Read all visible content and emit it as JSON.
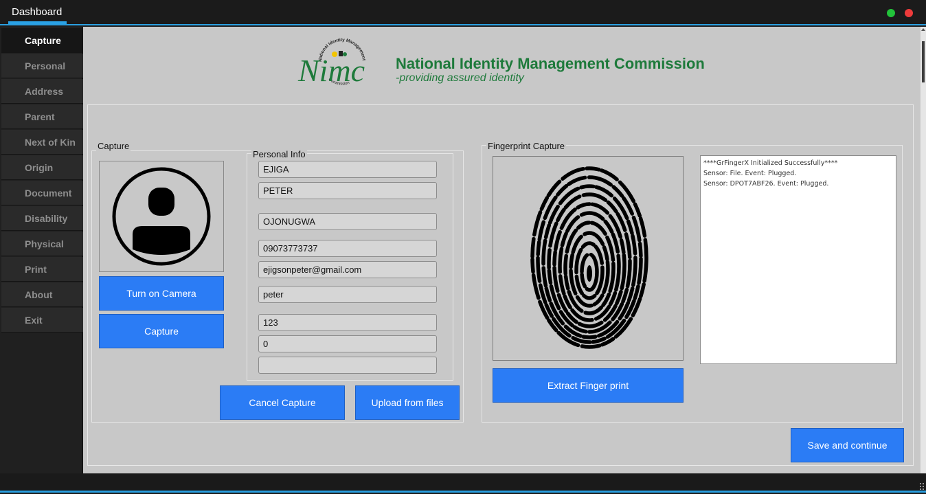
{
  "window": {
    "tab_label": "Dashboard",
    "controls": {
      "minimize_color": "#22c33a",
      "close_color": "#ee3b3b"
    }
  },
  "sidebar": {
    "items": [
      {
        "label": "Capture",
        "active": true
      },
      {
        "label": "Personal"
      },
      {
        "label": "Address"
      },
      {
        "label": "Parent"
      },
      {
        "label": "Next of Kin"
      },
      {
        "label": "Origin"
      },
      {
        "label": "Document"
      },
      {
        "label": "Disability"
      },
      {
        "label": "Physical"
      },
      {
        "label": "Print"
      },
      {
        "label": "About"
      },
      {
        "label": "Exit"
      }
    ]
  },
  "header": {
    "logo_text": "Nimc",
    "logo_ring_top": "National Identity Management",
    "logo_ring_bottom": "Commission",
    "org_title": "National Identity Management Commission",
    "tagline": "-providing assured identity",
    "brand_color": "#1e7a3b"
  },
  "capture": {
    "group_label": "Capture",
    "photo_icon": "user-silhouette-icon",
    "turn_on_camera_label": "Turn on Camera",
    "capture_label": "Capture",
    "cancel_capture_label": "Cancel Capture",
    "upload_label": "Upload from files"
  },
  "personal_info": {
    "group_label": "Personal Info",
    "fields": [
      "EJIGA",
      "PETER",
      "OJONUGWA",
      "09073773737",
      "ejigsonpeter@gmail.com",
      "peter",
      "123",
      "0",
      ""
    ]
  },
  "fingerprint": {
    "group_label": "Fingerprint Capture",
    "image_icon": "fingerprint-icon",
    "extract_label": "Extract Finger print",
    "log": [
      "****GrFingerX Initialized Successfully****",
      "Sensor: File. Event: Plugged.",
      "Sensor: DPOT7ABF26. Event: Plugged."
    ]
  },
  "footer": {
    "save_label": "Save and continue"
  },
  "colors": {
    "accent_blue": "#2b7cf5",
    "titlebar_accent": "#2a9fe0",
    "panel_bg": "#c8c8c8"
  }
}
